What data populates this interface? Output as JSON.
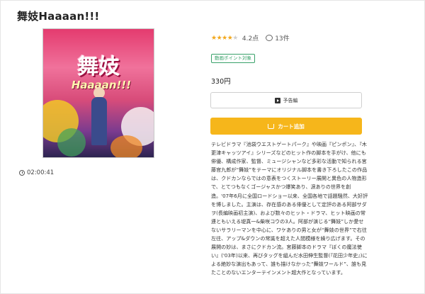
{
  "page": {
    "title": "舞妓Haaaan!!!"
  },
  "poster": {
    "title_text": "舞妓",
    "subtitle_text": "Haaaan!!!"
  },
  "duration": "02:00:41",
  "rating": {
    "stars": 4.2,
    "score": "4.2点",
    "comment_count": "13件"
  },
  "badge": "動画ポイント対象",
  "price": "330円",
  "buttons": {
    "preview": "予告編",
    "add_cart": "カート追加"
  },
  "description": "テレビドラマ『池袋ウエストゲートパーク』や映画『ピンポン』、『木更津キャッツアイ』シリーズなどのヒット作の脚本を手がけ、他にも俳優、構成作家、監督、ミュージシャンなど多彩な活動で知られる宮藤官九郎が“舞妓”をテーマにオリジナル脚本を書き下ろしたこの作品は、クドカンならではの意表をつくストーリー展開と異色の人物造形で、とてつもなくゴージャスかつ爆笑あり、涙ありの世界を創造。'07年6月に全国ロードショー以来、全国各地で話題騒然、大好評を博しました。主演は、存在感のある俳優として定評のある阿部サダヲ(長編映画初主演)、および数々のヒット・ドラマ、ヒット映画の常連ともいえる堤真一&柴咲コウの3人。阿部が演じる“舞妓”しか愛せないサラリーマンを中心に、ワケありの男と女が“舞妓の世界”で右往左往、アップ&ダウンの常識を超えた人間模様を繰り広げます。その展開の妙は、まさにクドカン流。宮藤脚本のドラマ『ぼくの魔法使い』('03年)以来、再びタッグを組んだ水田伸生監督(『花田少年史』)による絶妙な演出もあって、誰も描けなかった“舞妓ワールド”、誰も見たことのないエンターテインメント超大作となっています。",
  "colors": {
    "accent": "#f6b61b",
    "badge": "#38a169",
    "star": "#f2a81d"
  }
}
